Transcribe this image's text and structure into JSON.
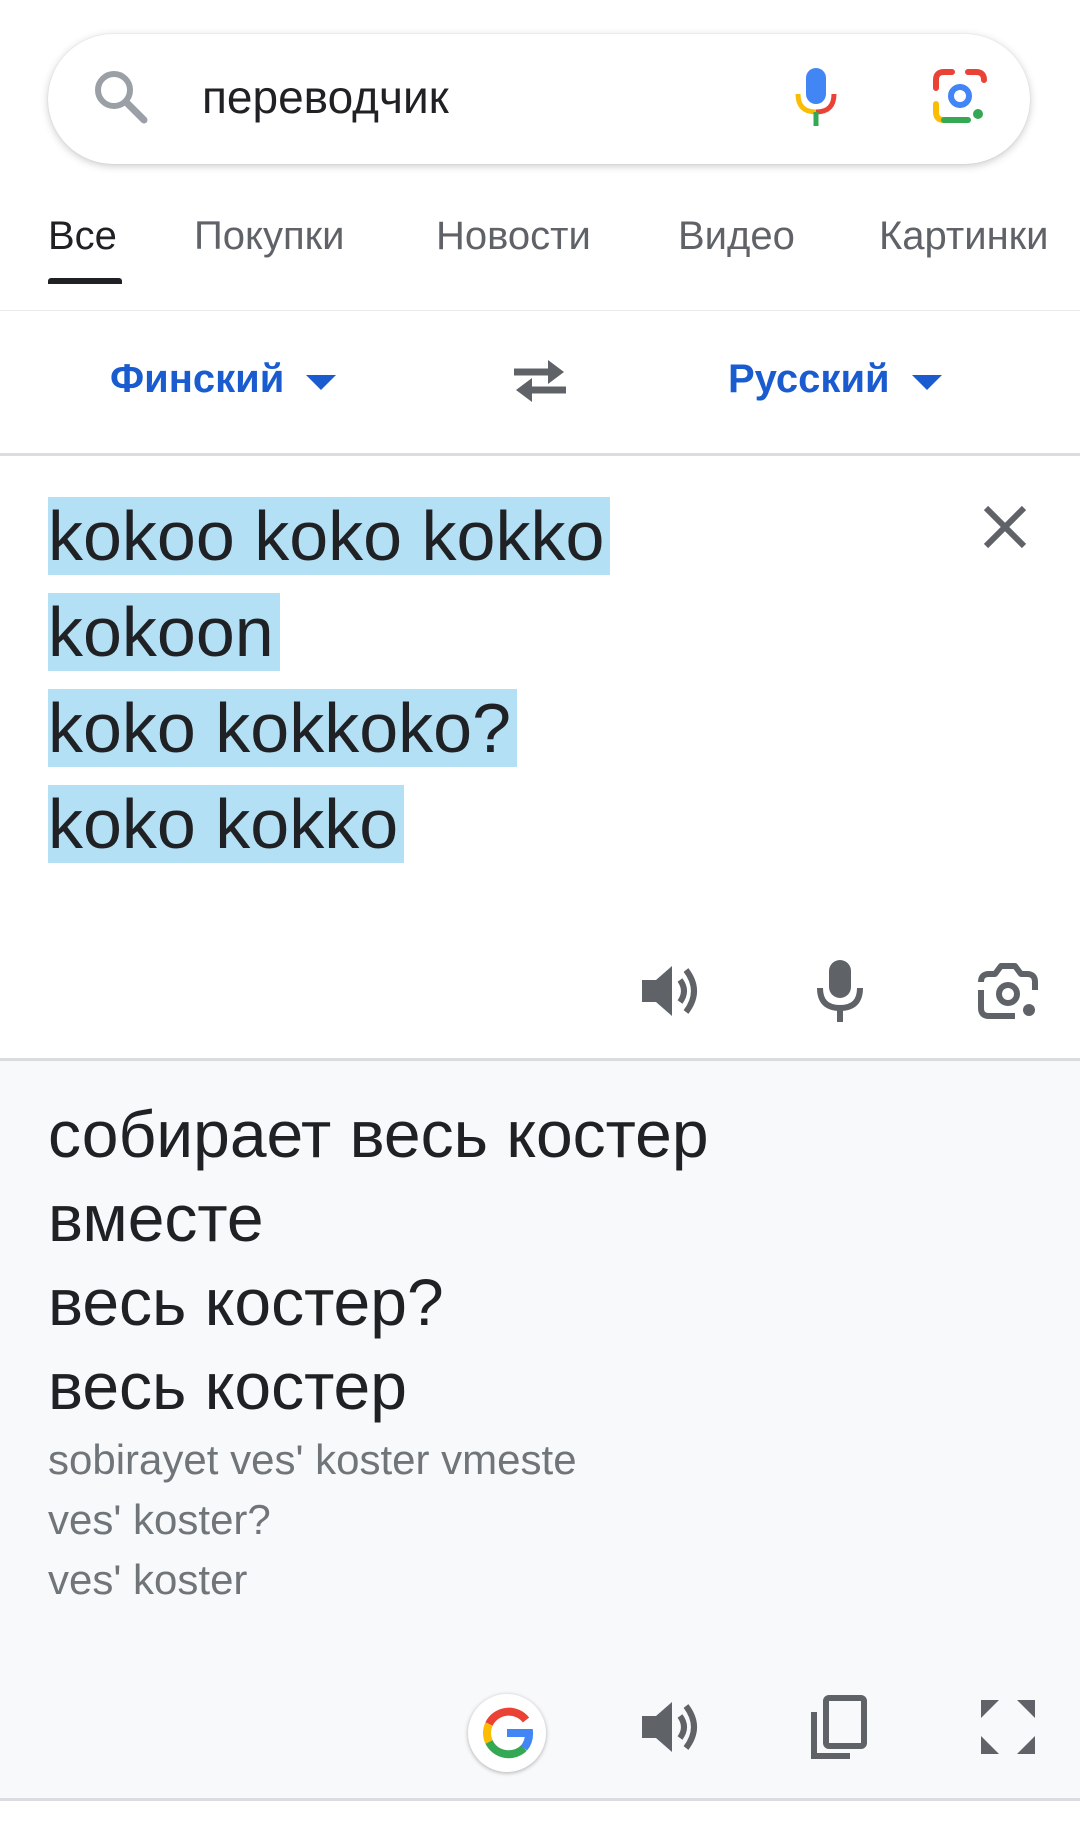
{
  "search": {
    "query": "переводчик"
  },
  "tabs": [
    {
      "label": "Все",
      "active": true
    },
    {
      "label": "Покупки"
    },
    {
      "label": "Новости"
    },
    {
      "label": "Видео"
    },
    {
      "label": "Картинки"
    }
  ],
  "translator": {
    "source_language": "Финский",
    "target_language": "Русский",
    "source_lines": [
      "kokoo koko kokko",
      "kokoon",
      "koko kokkoko?",
      "koko kokko"
    ],
    "translation": "собирает весь костер\nвместе\nвесь костер?\nвесь костер",
    "transliteration": "sobirayet ves' koster vmeste\nves' koster?\nves' koster"
  },
  "colors": {
    "accent": "#1a5cd0",
    "highlight": "#b3e0f5",
    "icon_gray": "#5f6368",
    "result_background": "#f8f9fa"
  },
  "icons": [
    "search-icon",
    "mic-icon",
    "lens-icon",
    "swap-icon",
    "close-icon",
    "speaker-icon",
    "camera-icon",
    "google-icon",
    "copy-icon",
    "expand-icon"
  ]
}
